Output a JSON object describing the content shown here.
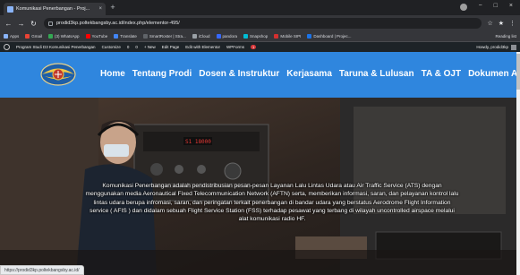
{
  "browser": {
    "tab_title": "Komunikasi Penerbangan - Proj...",
    "tab_close": "×",
    "new_tab": "+",
    "url": "prodid3kp.poltekbangsby.ac.id/index.php/elementor-495/",
    "window_controls": [
      "−",
      "□",
      "×"
    ],
    "toolbar_icons": [
      "☆",
      "★",
      "⋮"
    ]
  },
  "bookmarks": [
    {
      "label": "Apps",
      "color": "#8ab4f8"
    },
    {
      "label": "Gmail",
      "color": "#ea4335"
    },
    {
      "label": "(3) WhatsApp",
      "color": "#34a853"
    },
    {
      "label": "YouTube",
      "color": "#ff0000"
    },
    {
      "label": "Translate",
      "color": "#4285f4"
    },
    {
      "label": "SmartRoster | Stra...",
      "color": "#5f6368"
    },
    {
      "label": "iCloud",
      "color": "#9aa0a6"
    },
    {
      "label": "pandora",
      "color": "#3668ff"
    },
    {
      "label": "Snapshop",
      "color": "#00bcd4"
    },
    {
      "label": "Mobile SIPI",
      "color": "#d32f2f"
    },
    {
      "label": "Dashboard | Projec...",
      "color": "#1a73e8"
    }
  ],
  "reading_list": "Reading list",
  "adminbar": {
    "items": [
      "Program Studi D3 Komunikasi Penerbangan",
      "Customize",
      "0",
      "0",
      "+ New",
      "Edit Page",
      "Edit with Elementor",
      "WPForms"
    ],
    "badge": "1",
    "howdy": "Howdy, prodid3kp"
  },
  "nav": {
    "items": [
      "Home",
      "Tentang Prodi",
      "Dosen & Instruktur",
      "Kerjasama",
      "Taruna & Lulusan",
      "TA & OJT",
      "Dokumen Aturan"
    ]
  },
  "hero": {
    "description": "Komunikasi Penerbangan adalah pendistribusian pesan-pesan Layanan Lalu Lintas Udara atau Air Traffic Service (ATS) dengan menggunakan media Aeronautical Fixed Telecommunication Network (AFTN) serta, memberikan informasi, saran, dan pelayanan kontrol lalu lintas udara berupa infromasi, saran, dan peringatan terkait penerbangan di bandar udara yang berstatus Aerodrome Flight Information service ( AFIS ) dan didalam sebuah Flight Service Station (FSS) terhadap pesawat yang terbang di wilayah uncontrolled airspace melalui alat komunikasi radio HF.",
    "radio_display": "S1 18000"
  },
  "status_url": "https://prodid3kp.poltekbangsby.ac.id/"
}
